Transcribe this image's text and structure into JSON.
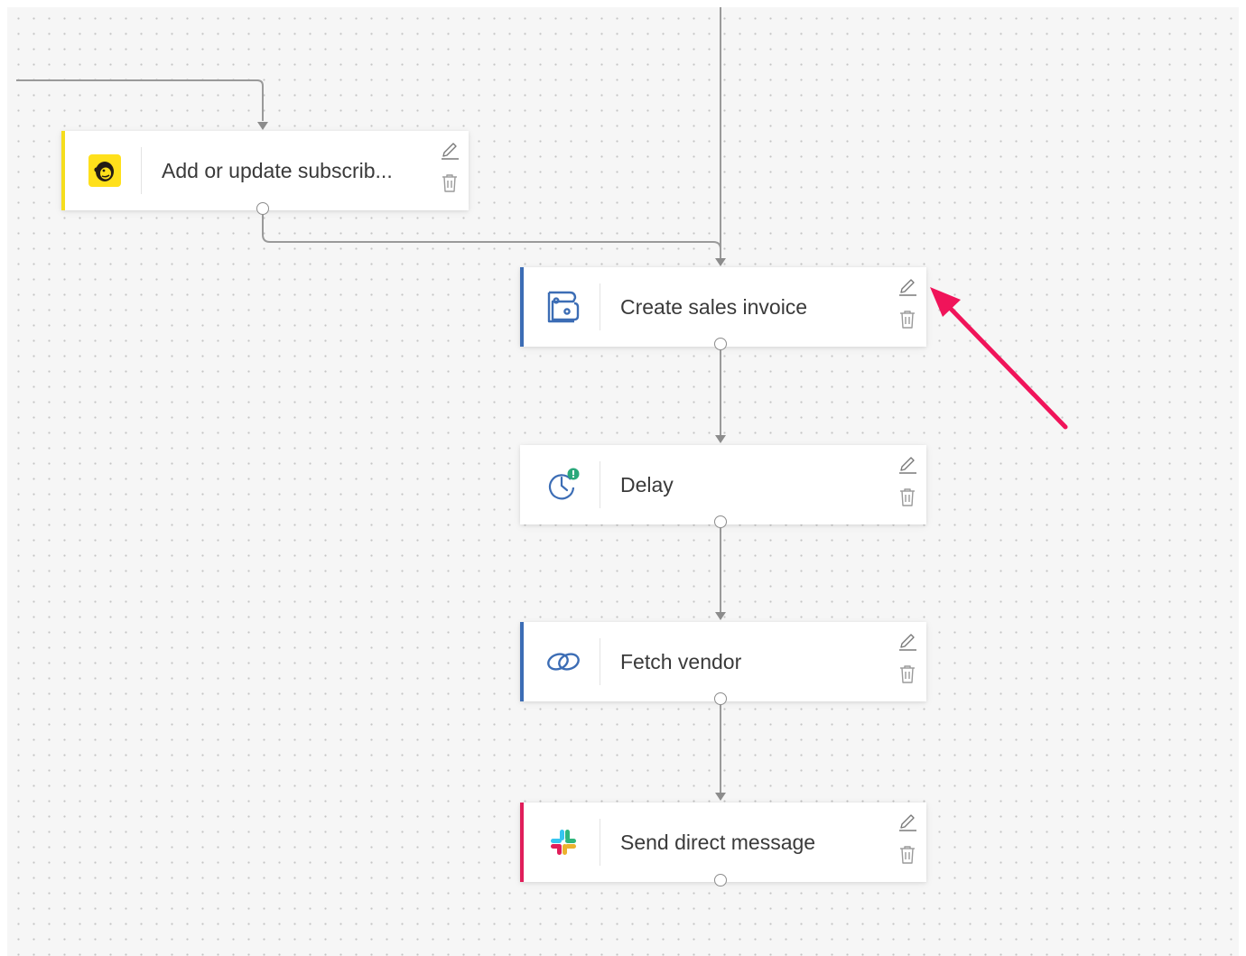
{
  "nodes": [
    {
      "id": "mailchimp",
      "label": "Add or update subscrib...",
      "app_icon": "mailchimp-icon",
      "accent": "#f5dd1d"
    },
    {
      "id": "invoice",
      "label": "Create sales invoice",
      "app_icon": "zoho-books-icon",
      "accent": "#3c6db5"
    },
    {
      "id": "delay",
      "label": "Delay",
      "app_icon": "clock-alert-icon",
      "accent": "#ffffff"
    },
    {
      "id": "fetch",
      "label": "Fetch vendor",
      "app_icon": "zoho-flow-link-icon",
      "accent": "#3c6db5"
    },
    {
      "id": "slack",
      "label": "Send direct message",
      "app_icon": "slack-icon",
      "accent": "#e01e5a"
    }
  ],
  "actions": {
    "edit_icon": "pencil-icon",
    "delete_icon": "trash-icon"
  },
  "annotation": {
    "icon": "arrow-icon",
    "color": "#f0145a"
  },
  "colors": {
    "canvas": "#f6f6f6",
    "connector": "#9a9a9a"
  }
}
